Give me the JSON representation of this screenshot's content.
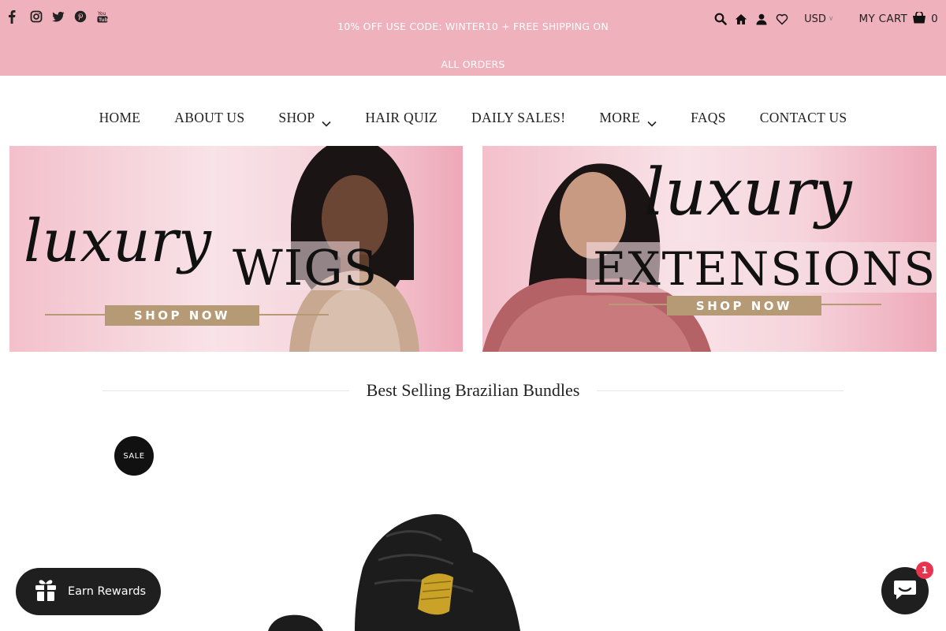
{
  "header": {
    "social_icons": [
      "facebook-icon",
      "instagram-icon",
      "twitter-icon",
      "pinterest-icon",
      "youtube-icon"
    ],
    "announcement": "10% OFF USE CODE: WINTER10 + FREE SHIPPING ON ALL ORDERS",
    "currency": "USD",
    "cart_label": "MY CART",
    "cart_count": "0",
    "brand_bar_color": "#efb1bb"
  },
  "nav": {
    "home": "HOME",
    "about": "ABOUT US",
    "shop": "SHOP",
    "quiz": "HAIR QUIZ",
    "sales": "DAILY SALES!",
    "more": "MORE",
    "faqs": "FAQS",
    "contact": "CONTACT US"
  },
  "banners": {
    "left": {
      "script": "luxury",
      "title": "WIGS",
      "button": "SHOP NOW"
    },
    "right": {
      "script": "luxury",
      "title": "EXTENSIONS",
      "button": "SHOP NOW"
    },
    "button_color": "#b59a75"
  },
  "section": {
    "title": "Best Selling Brazilian Bundles"
  },
  "product": {
    "badge": "SALE"
  },
  "widgets": {
    "rewards_label": "Earn Rewards",
    "chat_badge": "1",
    "badge_color": "#e8344e"
  }
}
